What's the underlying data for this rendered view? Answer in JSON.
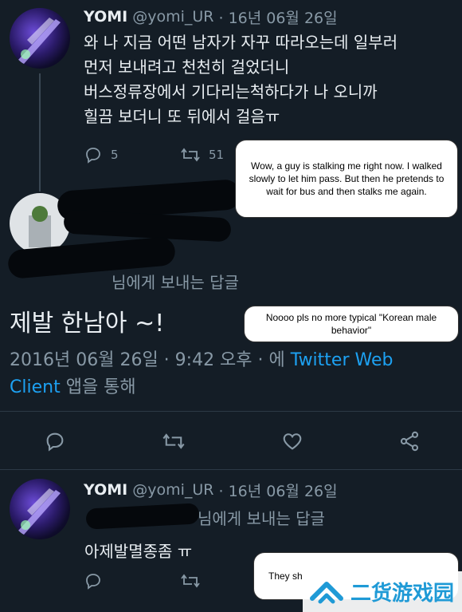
{
  "tweet1": {
    "name": "YOMI",
    "handle": "@yomi_UR",
    "date": "· 16년 06월 26일",
    "text": "와 나 지금 어떤 남자가 자꾸 따라오는데 일부러\n먼저 보내려고 천천히 걸었더니\n버스정류장에서 기다리는척하다가 나 오니까\n힐끔 보더니 또 뒤에서 걸음ㅠ",
    "reply_count": "5",
    "retweet_count": "51"
  },
  "tweet2": {
    "reply_to_suffix": "님에게 보내는 답글",
    "text": "제발 한남아 ~!",
    "timestamp": "2016년 06월 26일 · 9:42 오후 · 에 ",
    "source": "Twitter Web Client",
    "source_suffix": "앱을 통해"
  },
  "tweet3": {
    "name": "YOMI",
    "handle": "@yomi_UR",
    "date": "· 16년 06월 26일",
    "reply_to_suffix": "님에게 보내는 답글",
    "text": "아제발멸종좀 ㅠ"
  },
  "annotations": {
    "bubble1": "Wow, a guy is stalking me right now. I walked slowly to let him pass. But then he pretends to wait for bus and then stalks me again.",
    "bubble2": "Noooo pls no more typical \"Korean male behavior\"",
    "bubble3": "They sh"
  },
  "watermark": {
    "text": "二货游戏园"
  },
  "colors": {
    "background": "#141d26",
    "muted": "#8899a6",
    "link": "#1da1f2"
  }
}
